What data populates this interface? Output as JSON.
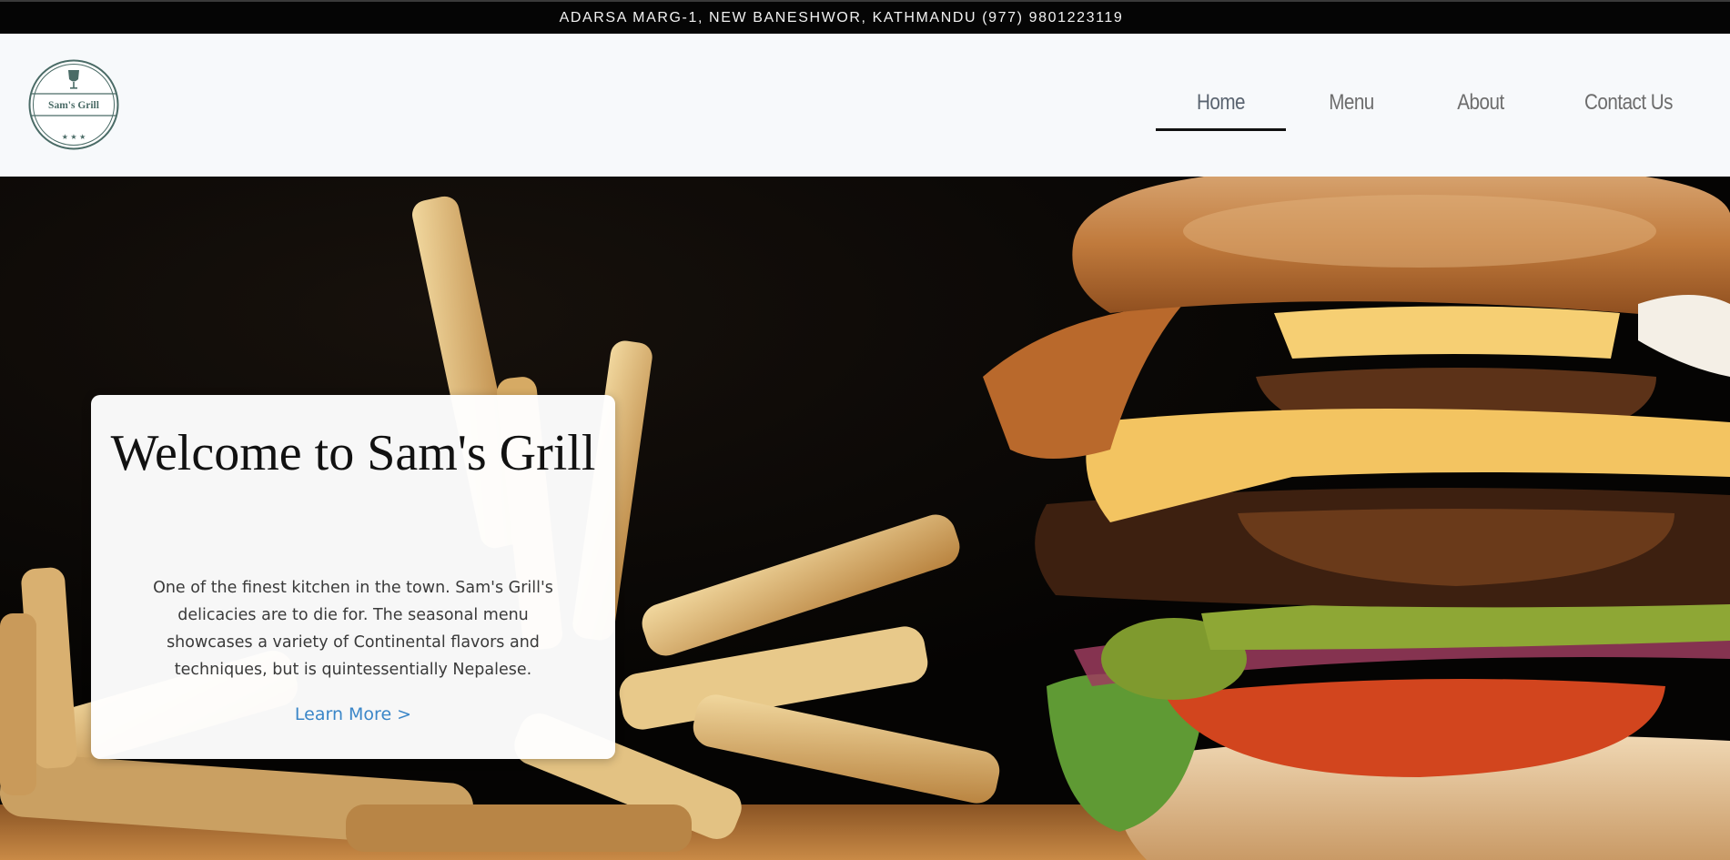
{
  "topbar": {
    "text": "ADARSA MARG-1, NEW BANESHWOR, KATHMANDU (977) 9801223119"
  },
  "logo": {
    "text": "Sam's Grill",
    "icon": "wine-glass-icon",
    "stars": "★ ★ ★"
  },
  "nav": {
    "items": [
      {
        "label": "Home",
        "active": true
      },
      {
        "label": "Menu",
        "active": false
      },
      {
        "label": "About",
        "active": false
      },
      {
        "label": "Contact Us",
        "active": false
      }
    ]
  },
  "hero": {
    "title": "Welcome to Sam's Grill",
    "description": "One of the finest kitchen in the town. Sam's Grill's delicacies are to die for. The seasonal menu showcases a variety of Continental flavors and techniques, but is quintessentially Nepalese.",
    "cta_label": "Learn More >",
    "image": "burger-and-fries-photo"
  },
  "colors": {
    "topbar_bg": "#050505",
    "header_bg": "#f7f9fb",
    "link": "#3a86c8",
    "logo": "#4a6b66"
  }
}
